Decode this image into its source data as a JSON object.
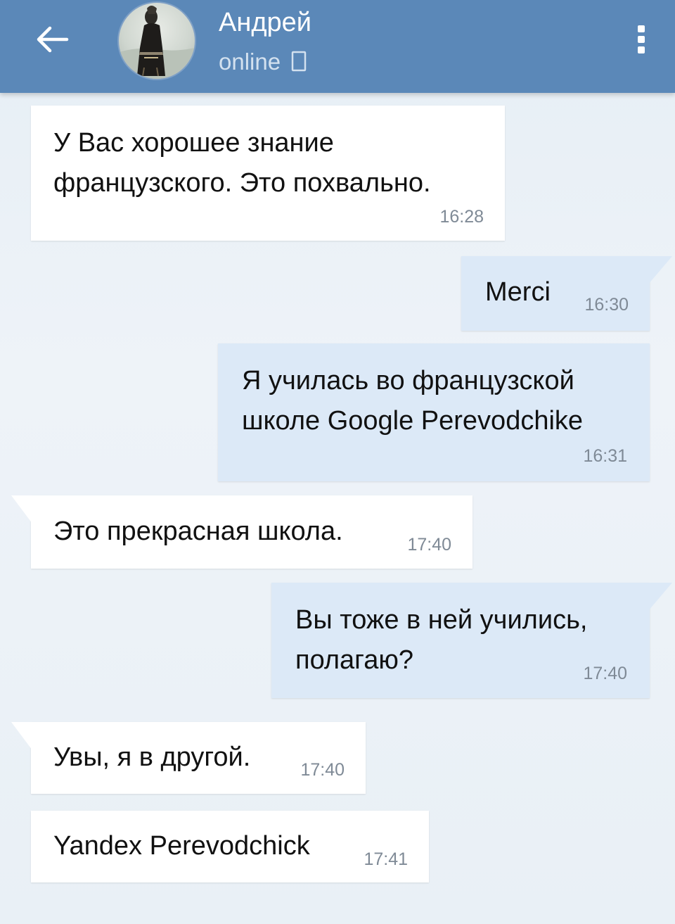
{
  "header": {
    "back_icon": "arrow-left-icon",
    "contact_name": "Андрей",
    "status": "online",
    "status_icon": "device-icon",
    "menu_icon": "more-vertical-icon",
    "bar_color": "#5b88b8"
  },
  "messages": [
    {
      "direction": "in",
      "text_lines": [
        "У Вас хорошее знание",
        "французского. Это похвально."
      ],
      "time": "16:28"
    },
    {
      "direction": "out",
      "text_lines": [
        "Merci"
      ],
      "time": "16:30"
    },
    {
      "direction": "out",
      "text_lines": [
        "Я училась во французской",
        "школе Google Perevodchike"
      ],
      "time": "16:31"
    },
    {
      "direction": "in",
      "text_lines": [
        "Это прекрасная школа."
      ],
      "time": "17:40"
    },
    {
      "direction": "out",
      "text_lines": [
        "Вы тоже в ней учились,",
        "полагаю?"
      ],
      "time": "17:40"
    },
    {
      "direction": "in",
      "text_lines": [
        "Увы, я в другой."
      ],
      "time": "17:40"
    },
    {
      "direction": "in",
      "text_lines": [
        "Yandex Perevodchick"
      ],
      "time": "17:41"
    }
  ],
  "colors": {
    "incoming_bubble": "#ffffff",
    "outgoing_bubble": "#dce9f7",
    "background": "#e9f0f6"
  }
}
